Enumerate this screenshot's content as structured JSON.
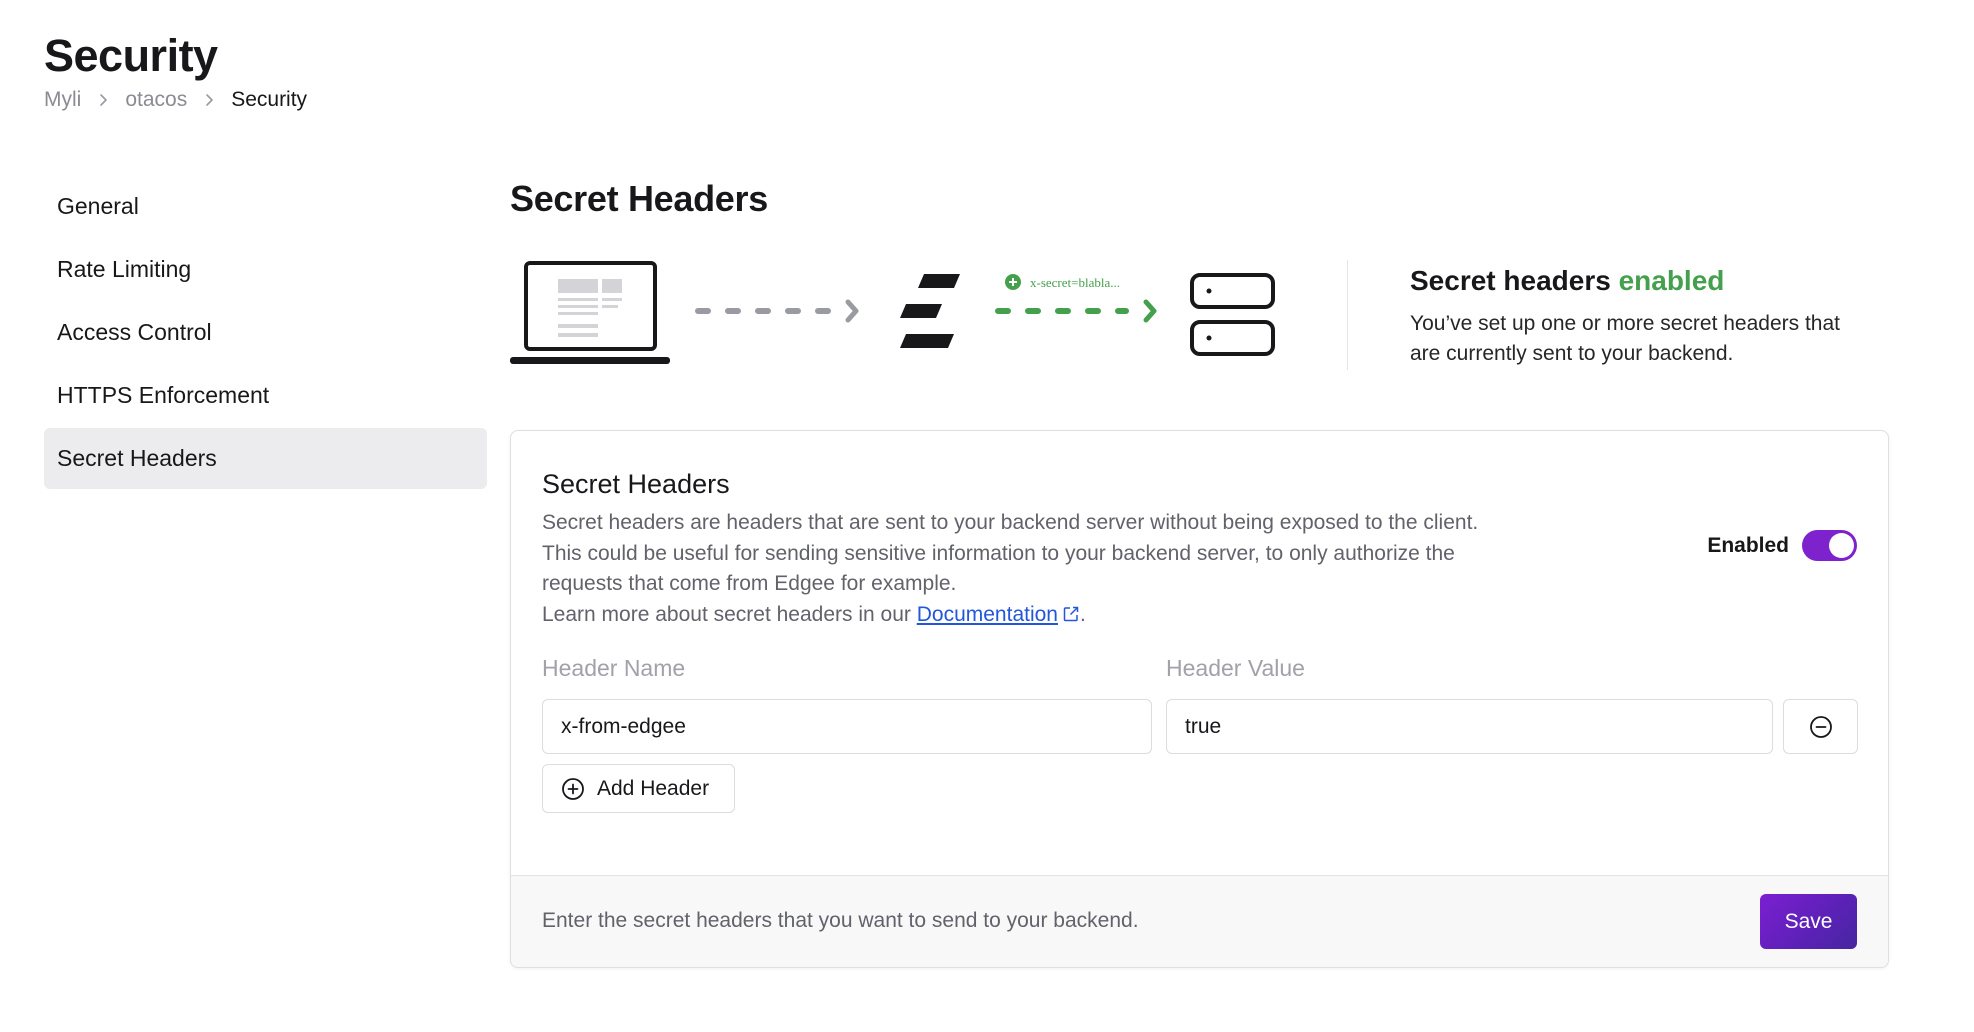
{
  "page": {
    "title": "Security"
  },
  "breadcrumb": [
    "Myli",
    "otacos",
    "Security"
  ],
  "sidebar": {
    "items": [
      {
        "label": "General"
      },
      {
        "label": "Rate Limiting"
      },
      {
        "label": "Access Control"
      },
      {
        "label": "HTTPS Enforcement"
      },
      {
        "label": "Secret Headers",
        "active": true
      }
    ]
  },
  "section": {
    "title": "Secret Headers"
  },
  "illustration": {
    "header_example": "x-secret=blabla...",
    "icons": [
      "laptop-icon",
      "arrow-right-icon",
      "edgee-logo-icon",
      "plus-circle-icon",
      "server-icon"
    ]
  },
  "status": {
    "title_prefix": "Secret headers",
    "title_accent": "enabled",
    "description": "You’ve set up one or more secret headers that are currently sent to your backend.",
    "accent_color": "#45a04d"
  },
  "card": {
    "title": "Secret Headers",
    "description": "Secret headers are headers that are sent to your backend server without being exposed to the client. This could be useful for sending sensitive information to your backend server, to only authorize the requests that come from Edgee for example.",
    "learn_more_prefix": "Learn more about secret headers in our",
    "doc_link_label": "Documentation",
    "learn_more_suffix": ".",
    "toggle_label": "Enabled",
    "toggle_on": true,
    "toggle_color": "#7e22ce",
    "columns": {
      "name": "Header Name",
      "value": "Header Value"
    },
    "headers": [
      {
        "name": "x-from-edgee",
        "value": "true"
      }
    ],
    "add_button_label": "Add Header",
    "footer_text": "Enter the secret headers that you want to send to your backend.",
    "save_label": "Save"
  }
}
